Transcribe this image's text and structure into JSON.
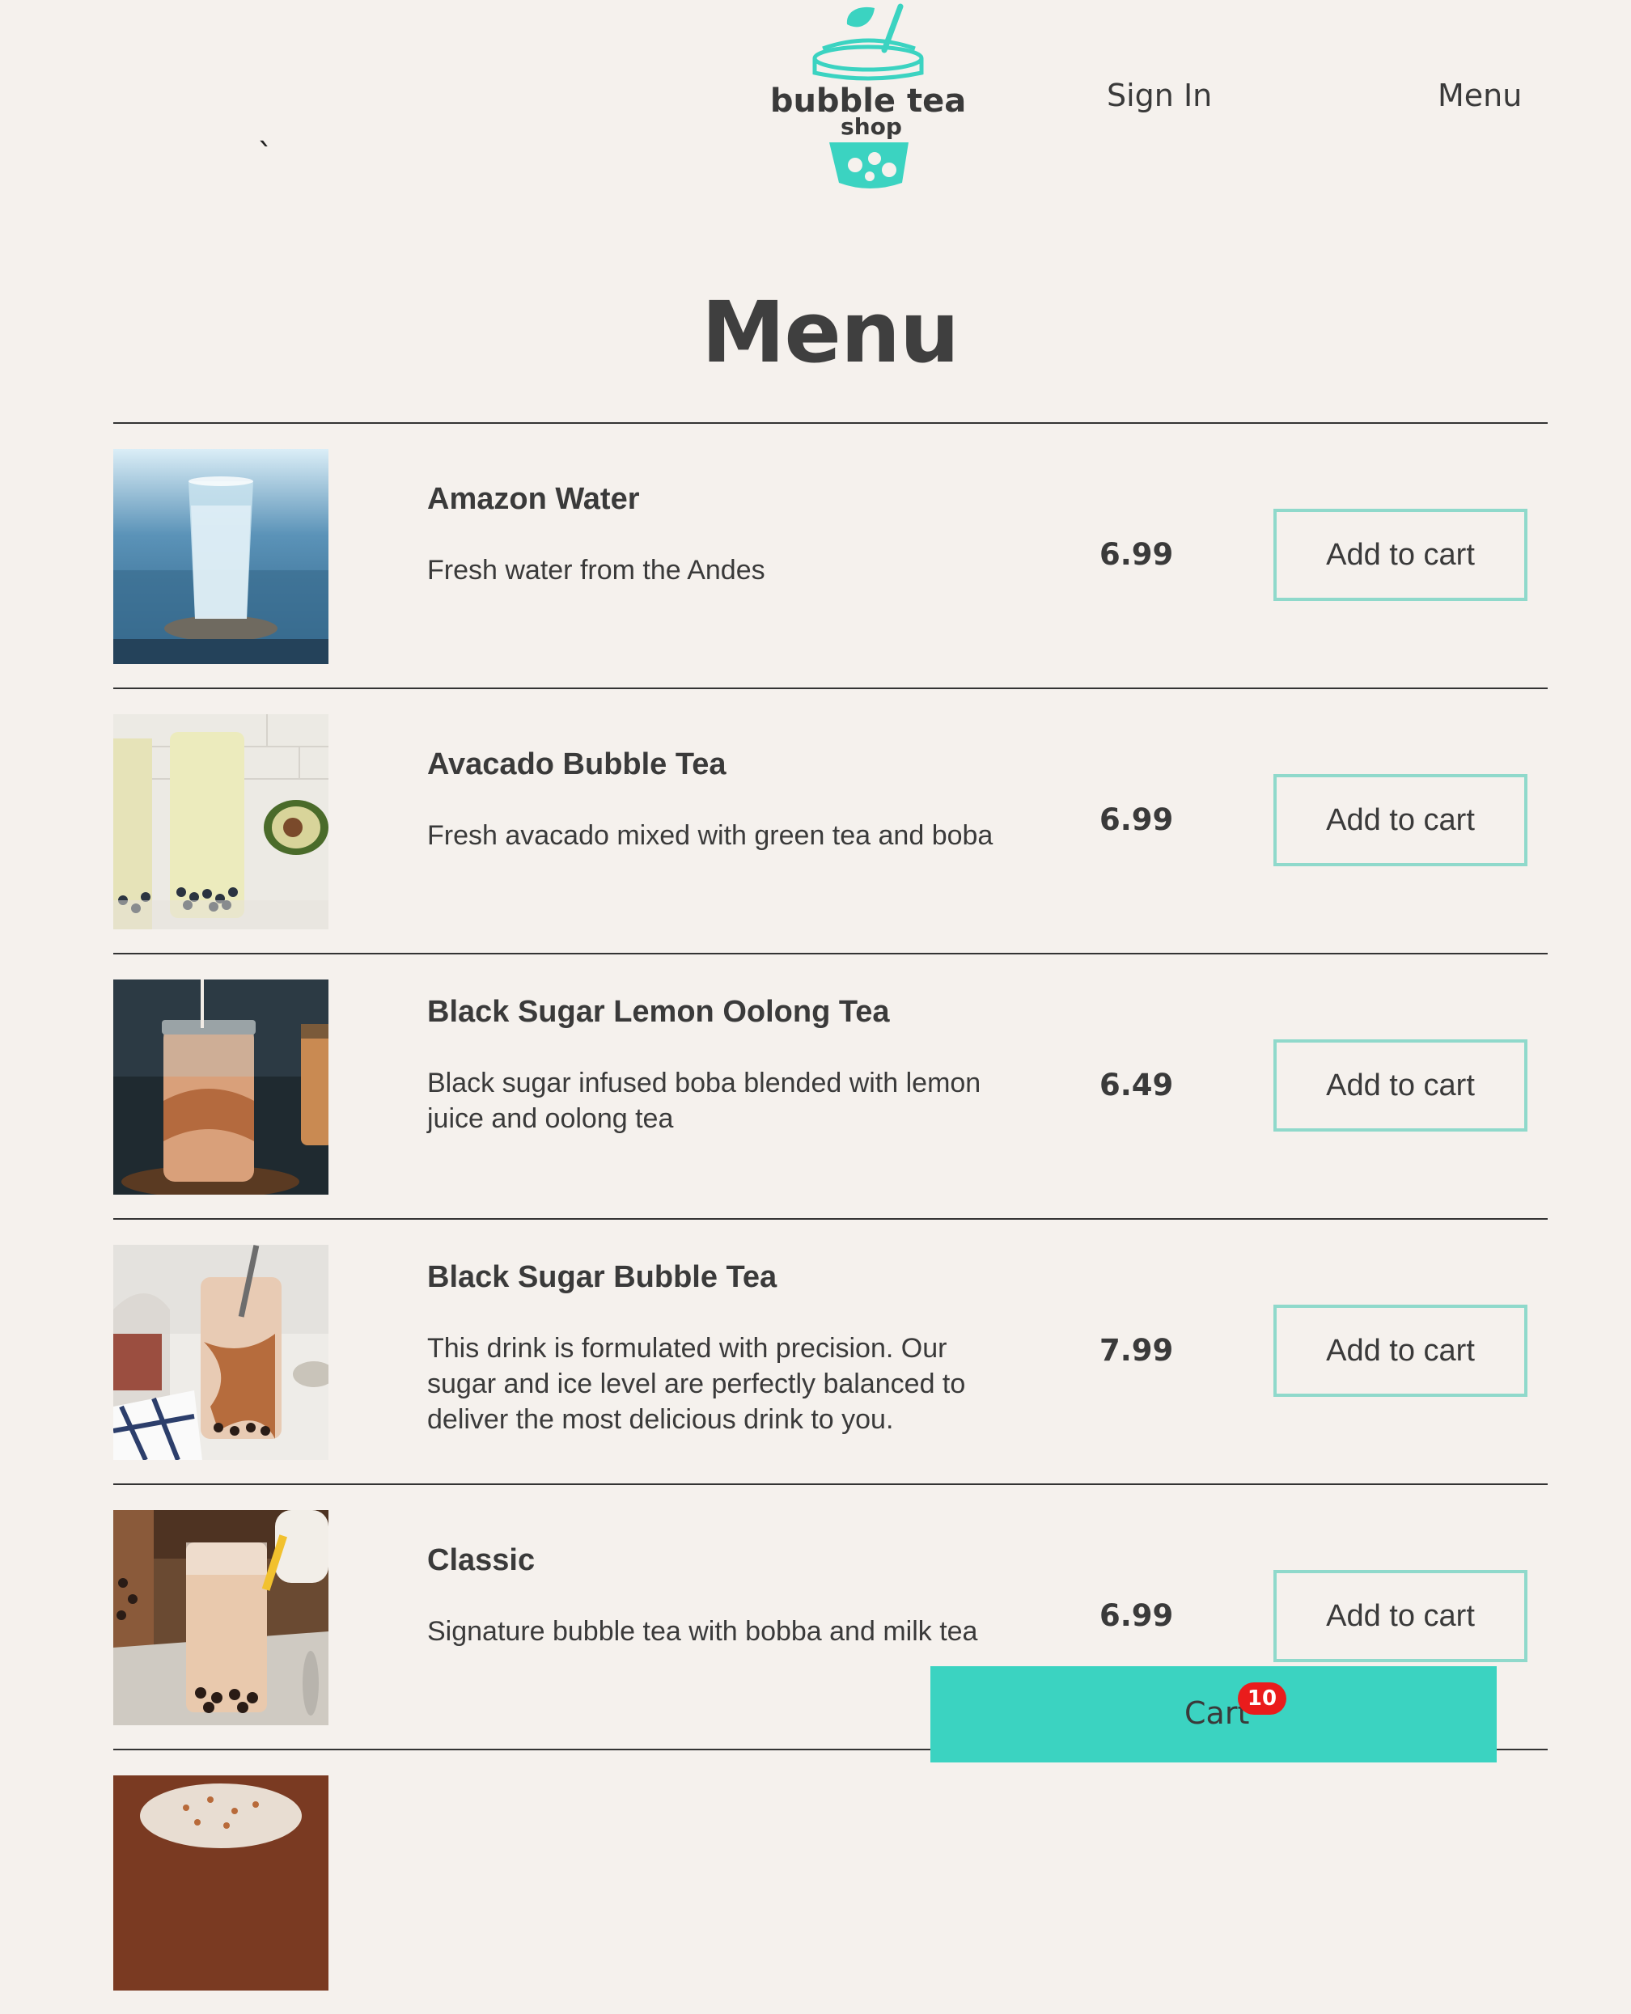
{
  "header": {
    "stray_mark": "`",
    "logo": {
      "line1": "bubble tea",
      "line2": "shop",
      "accent_color": "#3bd3c1"
    },
    "nav": {
      "sign_in": "Sign In",
      "menu": "Menu"
    }
  },
  "main": {
    "title": "Menu",
    "items": [
      {
        "name": "Amazon Water",
        "description": "Fresh water from the Andes",
        "price": "6.99",
        "button": "Add to cart",
        "image": "water-glass-image"
      },
      {
        "name": "Avacado Bubble Tea",
        "description": "Fresh avacado mixed with green tea and boba",
        "price": "6.99",
        "button": "Add to cart",
        "image": "avocado-tea-image"
      },
      {
        "name": "Black Sugar Lemon Oolong Tea",
        "description": "Black sugar infused boba blended with lemon juice and oolong tea",
        "price": "6.49",
        "button": "Add to cart",
        "image": "oolong-tea-image"
      },
      {
        "name": "Black Sugar Bubble Tea",
        "description": "This drink is formulated with precision. Our sugar and ice level are perfectly balanced to deliver the most delicious drink to you.",
        "price": "7.99",
        "button": "Add to cart",
        "image": "black-sugar-tea-image"
      },
      {
        "name": "Classic",
        "description": "Signature bubble tea with bobba and milk tea",
        "price": "6.99",
        "button": "Add to cart",
        "image": "classic-tea-image"
      },
      {
        "name": "",
        "description": "",
        "price": "",
        "button": "",
        "image": "partial-item-image"
      }
    ]
  },
  "cart": {
    "label": "Cart",
    "count": "10",
    "bar_color": "#3bd3c1",
    "badge_color": "#ea1c1c"
  },
  "colors": {
    "background": "#f5f1ed",
    "button_border": "#8fd9cb",
    "text": "#3a3a3a"
  }
}
